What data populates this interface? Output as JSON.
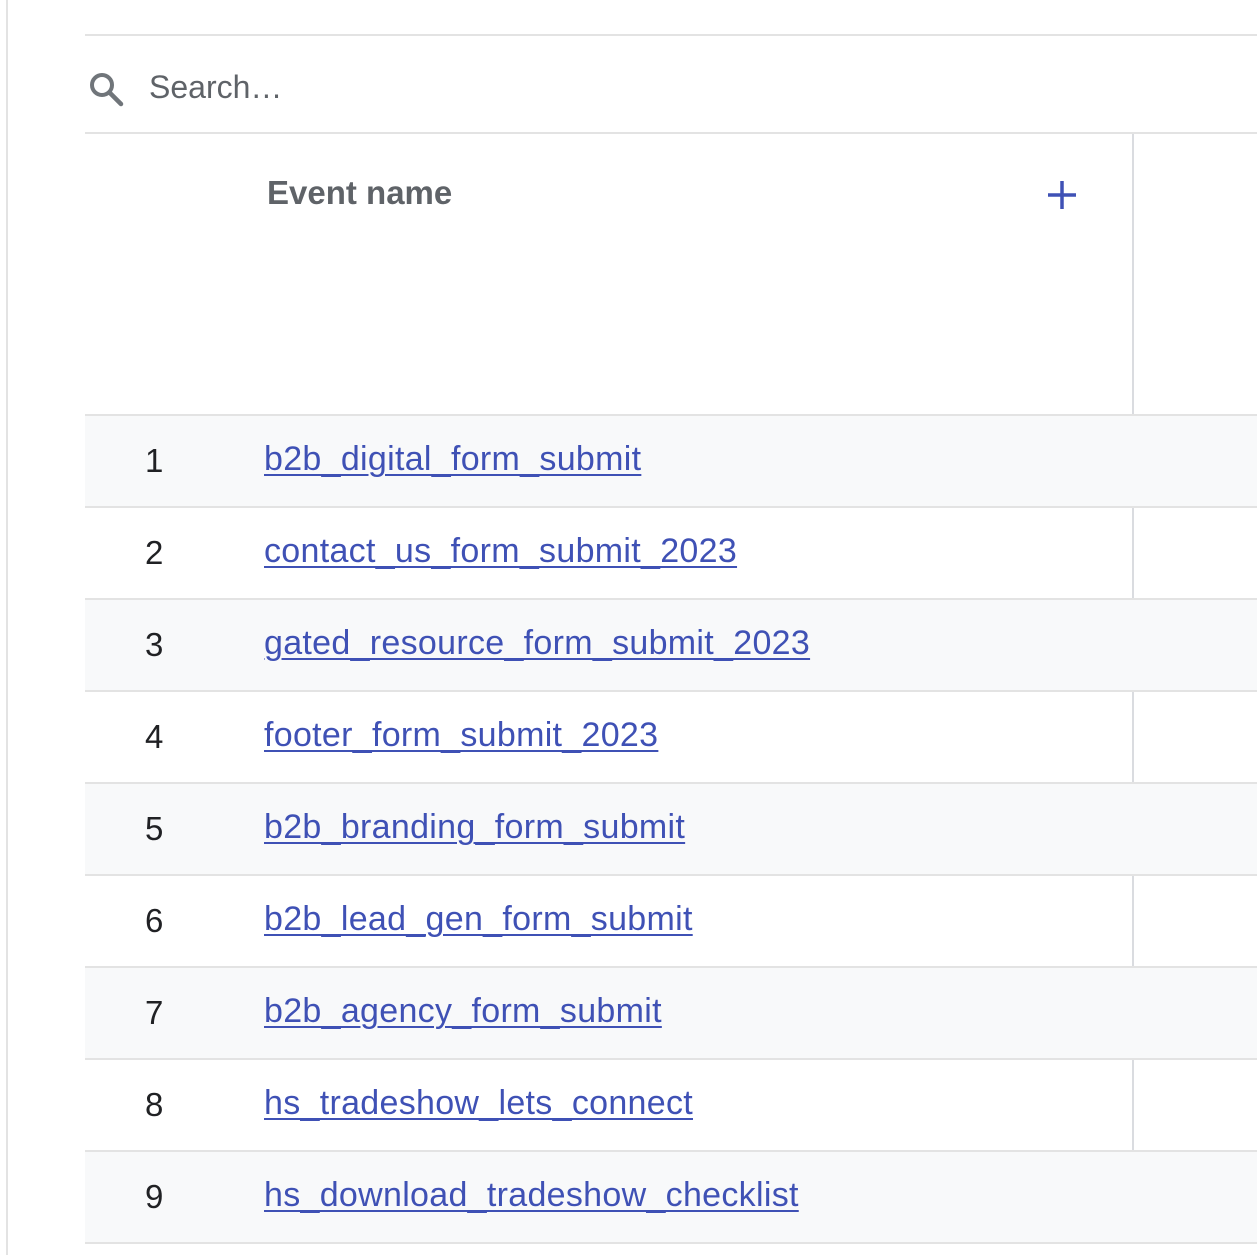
{
  "search": {
    "placeholder": "Search…",
    "value": ""
  },
  "table": {
    "column_header": "Event name",
    "add_icon": "plus-icon",
    "rows": [
      {
        "index": "1",
        "event_name": "b2b_digital_form_submit"
      },
      {
        "index": "2",
        "event_name": "contact_us_form_submit_2023"
      },
      {
        "index": "3",
        "event_name": "gated_resource_form_submit_2023"
      },
      {
        "index": "4",
        "event_name": "footer_form_submit_2023"
      },
      {
        "index": "5",
        "event_name": "b2b_branding_form_submit"
      },
      {
        "index": "6",
        "event_name": "b2b_lead_gen_form_submit"
      },
      {
        "index": "7",
        "event_name": "b2b_agency_form_submit"
      },
      {
        "index": "8",
        "event_name": "hs_tradeshow_lets_connect"
      },
      {
        "index": "9",
        "event_name": "hs_download_tradeshow_checklist"
      }
    ]
  },
  "colors": {
    "link": "#3f51b5",
    "accent": "#3f51b5",
    "shaded_row": "#f8f9fa",
    "divider": "#e3e3e3"
  }
}
